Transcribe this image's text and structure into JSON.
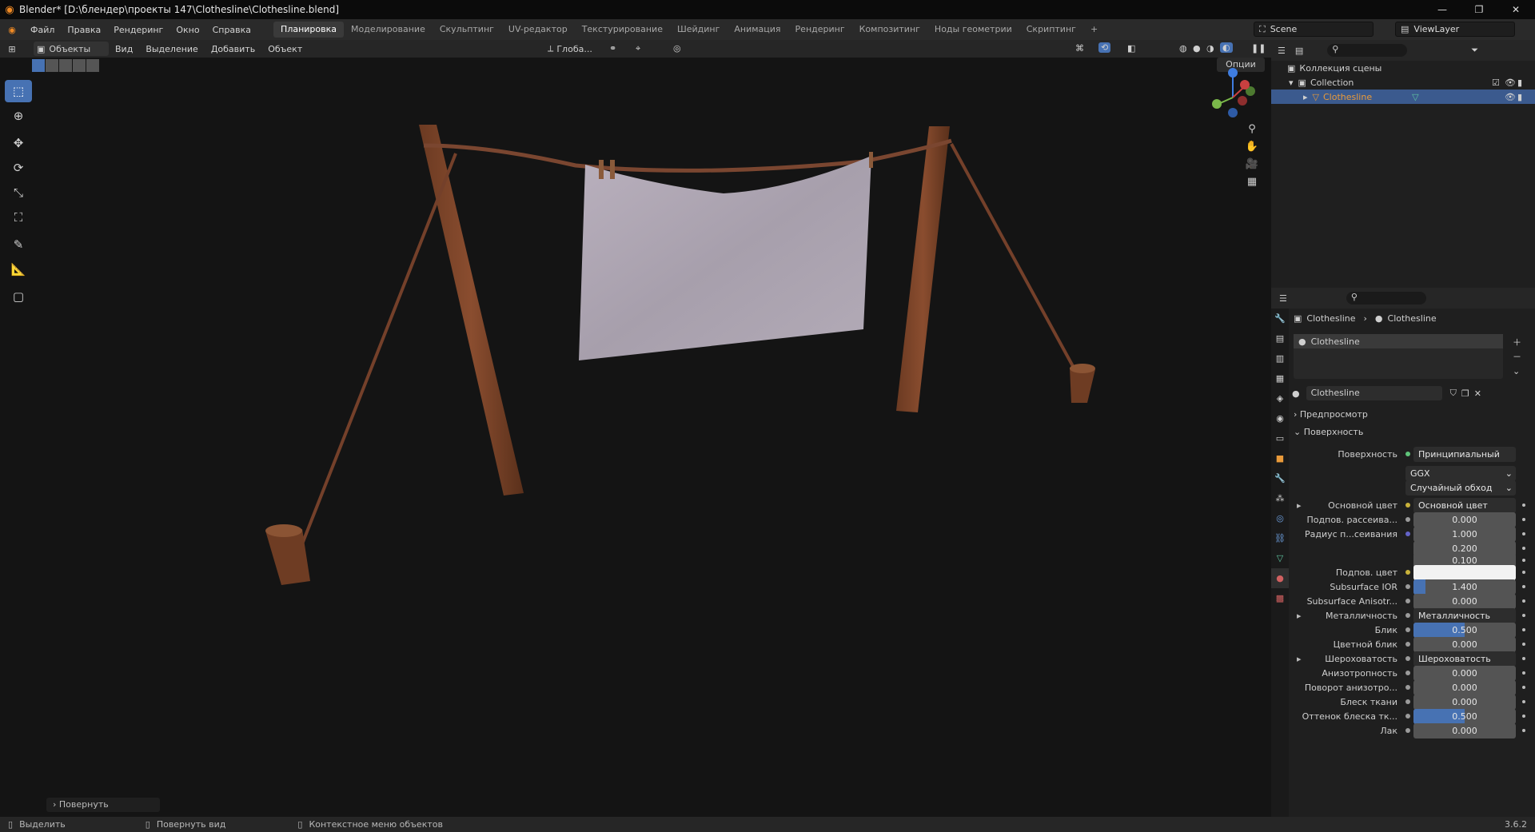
{
  "window": {
    "title": "Blender* [D:\\блендер\\проекты 147\\Clothesline\\Clothesline.blend]",
    "controls": [
      "minimize",
      "restore",
      "close"
    ]
  },
  "menu": [
    "Файл",
    "Правка",
    "Рендеринг",
    "Окно",
    "Справка"
  ],
  "workspaces": [
    {
      "label": "Планировка",
      "active": true
    },
    {
      "label": "Моделирование",
      "active": false
    },
    {
      "label": "Скульптинг",
      "active": false
    },
    {
      "label": "UV-редактор",
      "active": false
    },
    {
      "label": "Текстурирование",
      "active": false
    },
    {
      "label": "Шейдинг",
      "active": false
    },
    {
      "label": "Анимация",
      "active": false
    },
    {
      "label": "Рендеринг",
      "active": false
    },
    {
      "label": "Композитинг",
      "active": false
    },
    {
      "label": "Ноды геометрии",
      "active": false
    },
    {
      "label": "Скриптинг",
      "active": false
    }
  ],
  "scene": {
    "name": "Scene",
    "viewlayer": "ViewLayer"
  },
  "viewport_header": {
    "mode": "Объекты",
    "menus": [
      "Вид",
      "Выделение",
      "Добавить",
      "Объект"
    ],
    "transform": "Глоба...",
    "options": "Опции"
  },
  "tools": [
    "select-box",
    "cursor",
    "move",
    "rotate",
    "scale",
    "transform",
    "annotate",
    "measure",
    "add-cube"
  ],
  "last_operator": "Повернуть",
  "outliner": {
    "root": "Коллекция сцены",
    "collection": "Collection",
    "object": "Clothesline"
  },
  "properties": {
    "breadcrumb": [
      "Clothesline",
      "Clothesline"
    ],
    "material_slot": "Clothesline",
    "material_name": "Clothesline",
    "sections": {
      "preview": "Предпросмотр",
      "surface": "Поверхность"
    },
    "surface": {
      "label": "Поверхность",
      "value": "Принципиальный BSDF"
    },
    "distribution": "GGX",
    "subsurface_method": "Случайный обход",
    "rows": [
      {
        "label": "Основной цвет",
        "value": "Основной цвет",
        "kind": "link",
        "dot": "#c9b23a",
        "expand": true
      },
      {
        "label": "Подпов. рассеива...",
        "value": "0.000",
        "kind": "num",
        "fill": 0,
        "dot": "#9b9b9b"
      },
      {
        "label": "Радиус п...сеивания",
        "value": "1.000",
        "kind": "num",
        "fill": 0,
        "dot": "#6363c7"
      },
      {
        "label": "",
        "value": "0.200",
        "kind": "num",
        "fill": 0,
        "dot": ""
      },
      {
        "label": "",
        "value": "0.100",
        "kind": "num",
        "fill": 0,
        "dot": ""
      },
      {
        "label": "Подпов. цвет",
        "value": "",
        "kind": "color",
        "color": "#f2f2f2",
        "dot": "#c9b23a"
      },
      {
        "label": "Subsurface IOR",
        "value": "1.400",
        "kind": "num",
        "fill": 0.12,
        "dot": "#9b9b9b"
      },
      {
        "label": "Subsurface Anisotr...",
        "value": "0.000",
        "kind": "num",
        "fill": 0,
        "dot": "#9b9b9b"
      },
      {
        "label": "Металличность",
        "value": "Металличность",
        "kind": "link",
        "dot": "#9b9b9b",
        "expand": true
      },
      {
        "label": "Блик",
        "value": "0.500",
        "kind": "num",
        "fill": 0.5,
        "dot": "#9b9b9b"
      },
      {
        "label": "Цветной блик",
        "value": "0.000",
        "kind": "num",
        "fill": 0,
        "dot": "#9b9b9b"
      },
      {
        "label": "Шероховатость",
        "value": "Шероховатость",
        "kind": "link",
        "dot": "#9b9b9b",
        "expand": true
      },
      {
        "label": "Анизотропность",
        "value": "0.000",
        "kind": "num",
        "fill": 0,
        "dot": "#9b9b9b"
      },
      {
        "label": "Поворот анизотро...",
        "value": "0.000",
        "kind": "num",
        "fill": 0,
        "dot": "#9b9b9b"
      },
      {
        "label": "Блеск ткани",
        "value": "0.000",
        "kind": "num",
        "fill": 0,
        "dot": "#9b9b9b"
      },
      {
        "label": "Оттенок блеска тк...",
        "value": "0.500",
        "kind": "num",
        "fill": 0.5,
        "dot": "#9b9b9b"
      },
      {
        "label": "Лак",
        "value": "0.000",
        "kind": "num",
        "fill": 0,
        "dot": "#9b9b9b"
      }
    ]
  },
  "statusbar": {
    "items": [
      "Выделить",
      "Повернуть вид",
      "Контекстное меню объектов"
    ],
    "version": "3.6.2"
  },
  "colors": {
    "accent": "#4772b3",
    "selected": "#3b5a8e",
    "orange": "#e99a3a"
  }
}
